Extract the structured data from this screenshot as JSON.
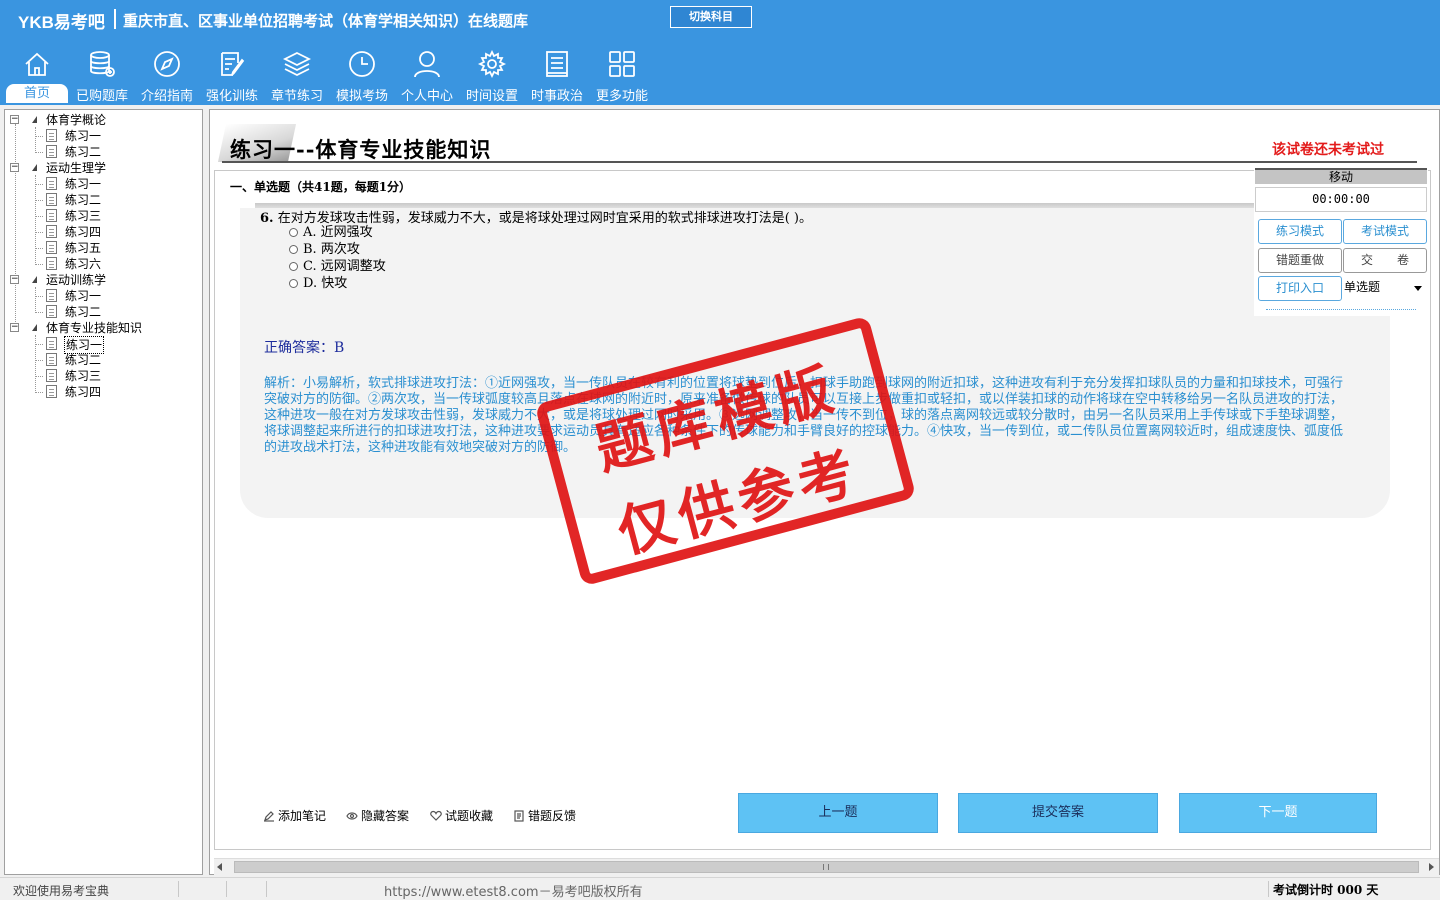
{
  "app": {
    "logo": "YKB易考吧",
    "title": "重庆市直、区事业单位招聘考试（体育学相关知识）在线题库",
    "switch_subject": "切换科目"
  },
  "nav": [
    {
      "label": "首页",
      "icon": "home-icon",
      "active": true
    },
    {
      "label": "已购题库",
      "icon": "database-icon"
    },
    {
      "label": "介绍指南",
      "icon": "compass-icon"
    },
    {
      "label": "强化训练",
      "icon": "edit-icon"
    },
    {
      "label": "章节练习",
      "icon": "layers-icon"
    },
    {
      "label": "模拟考场",
      "icon": "clock-icon"
    },
    {
      "label": "个人中心",
      "icon": "user-icon"
    },
    {
      "label": "时间设置",
      "icon": "gear-icon"
    },
    {
      "label": "时事政治",
      "icon": "news-icon"
    },
    {
      "label": "更多功能",
      "icon": "grid-icon"
    }
  ],
  "tree": [
    {
      "label": "体育学概论",
      "children": [
        "练习一",
        "练习二"
      ]
    },
    {
      "label": "运动生理学",
      "children": [
        "练习一",
        "练习二",
        "练习三",
        "练习四",
        "练习五",
        "练习六"
      ]
    },
    {
      "label": "运动训练学",
      "children": [
        "练习一",
        "练习二"
      ]
    },
    {
      "label": "体育专业技能知识",
      "children": [
        "练习一",
        "练习二",
        "练习三",
        "练习四"
      ]
    }
  ],
  "main": {
    "title": "练习一--体育专业技能知识",
    "status": "该试卷还未考试过",
    "section": "一、单选题（共41题，每题1分）",
    "question_number": "6.",
    "question_text": "在对方发球攻击性弱，发球威力不大，或是将球处理过网时宜采用的软式排球进攻打法是( )。",
    "options": [
      "A. 近网强攻",
      "B. 两次攻",
      "C. 远网调整攻",
      "D. 快攻"
    ],
    "answer": "正确答案：B",
    "analysis": "解析：小易解析，软式排球进攻打法：①近网强攻，当一传队员在较有利的位置将球垫到位后，扣球手助跑到球网的附近扣球，这种进攻有利于充分发挥扣球队员的力量和扣球技术，可强行突破对方的防御。②两次攻，当一传球弧度较高且落点在球网的附近时，原来准备做传球的队员可以互接上步做重扣或轻扣，或以佯装扣球的动作将球在空中转移给另一名队员进攻的打法，这种进攻一般在对方发球攻击性弱，发球威力不大，或是将球处理过网时采用。③远网调整攻，当一传不到位，球的落点离网较远或较分散时，由另一名队员采用上手传球或下手垫球调整，将球调整起来所进行的扣球进攻打法，这种进攻要求运动员具有适应各种条件下的传球能力和手臂良好的控球能力。④快攻，当一传到位，或二传队员位置离网较近时，组成速度快、弧度低的进攻战术打法，这种进攻能有效地突破对方的防御。"
  },
  "stamp": {
    "line1": "题库模版",
    "line2": "仅供参考"
  },
  "control": {
    "move": "移动",
    "timer": "00:00:00",
    "practice_mode": "练习模式",
    "exam_mode": "考试模式",
    "redo_wrong": "错题重做",
    "submit_paper": "交　　卷",
    "print_entry": "打印入口",
    "question_type": "单选题"
  },
  "toolbar": {
    "add_note": "添加笔记",
    "hide_answer": "隐藏答案",
    "favorite": "试题收藏",
    "feedback": "错题反馈",
    "prev": "上一题",
    "submit_answer": "提交答案",
    "next": "下一题"
  },
  "statusbar": {
    "welcome": "欢迎使用易考宝典",
    "copyright": "https://www.etest8.com－易考吧版权所有",
    "countdown": "考试倒计时 000 天"
  }
}
